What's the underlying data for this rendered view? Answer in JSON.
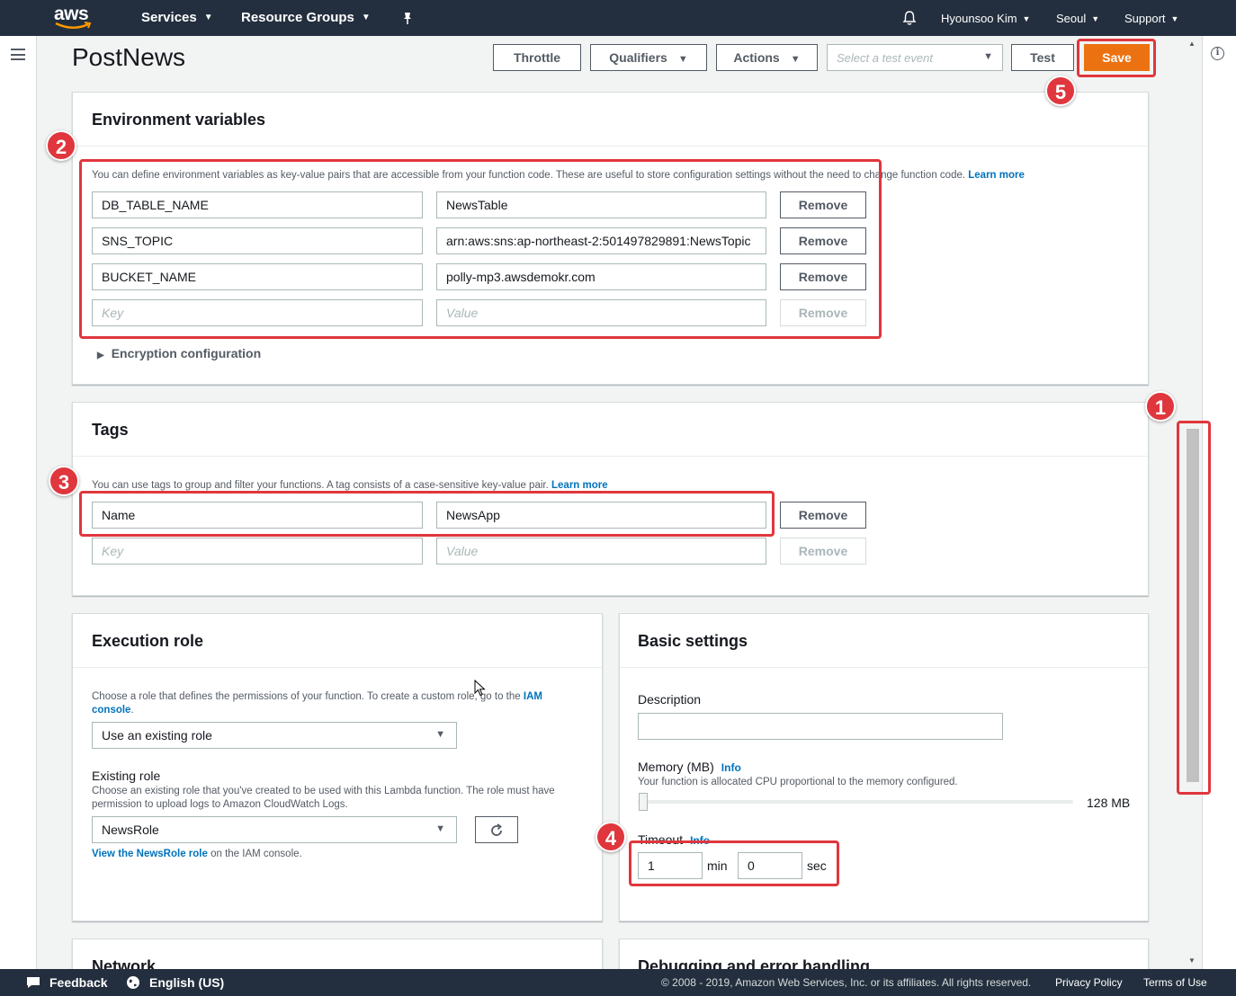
{
  "nav": {
    "logo": "aws",
    "services": "Services",
    "resource_groups": "Resource Groups",
    "pin_icon": "pin-icon",
    "bell_icon": "bell-icon",
    "user": "Hyounsoo Kim",
    "region": "Seoul",
    "support": "Support"
  },
  "header": {
    "title": "PostNews",
    "throttle": "Throttle",
    "qualifiers": "Qualifiers",
    "actions": "Actions",
    "test_event_placeholder": "Select a test event",
    "test": "Test",
    "save": "Save"
  },
  "env": {
    "title": "Environment variables",
    "help": "You can define environment variables as key-value pairs that are accessible from your function code. These are useful to store configuration settings without the need to change function code.",
    "learn_more": "Learn more",
    "rows": [
      {
        "key": "DB_TABLE_NAME",
        "value": "NewsTable",
        "remove": "Remove"
      },
      {
        "key": "SNS_TOPIC",
        "value": "arn:aws:sns:ap-northeast-2:501497829891:NewsTopic",
        "remove": "Remove"
      },
      {
        "key": "BUCKET_NAME",
        "value": "polly-mp3.awsdemokr.com",
        "remove": "Remove"
      }
    ],
    "empty_key": "Key",
    "empty_value": "Value",
    "empty_remove": "Remove",
    "encryption": "Encryption configuration"
  },
  "tags": {
    "title": "Tags",
    "help": "You can use tags to group and filter your functions. A tag consists of a case-sensitive key-value pair.",
    "learn_more": "Learn more",
    "rows": [
      {
        "key": "Name",
        "value": "NewsApp",
        "remove": "Remove"
      }
    ],
    "empty_key": "Key",
    "empty_value": "Value",
    "empty_remove": "Remove"
  },
  "exec_role": {
    "title": "Execution role",
    "help": "Choose a role that defines the permissions of your function. To create a custom role, go to the",
    "iam_link_1": "IAM",
    "iam_link_2": "console",
    "role_select": "Use an existing role",
    "existing_label": "Existing role",
    "existing_help": "Choose an existing role that you've created to be used with this Lambda function. The role must have permission to upload logs to Amazon CloudWatch Logs.",
    "existing_value": "NewsRole",
    "view_link": "View the NewsRole role",
    "view_suffix": " on the IAM console."
  },
  "basic": {
    "title": "Basic settings",
    "description_label": "Description",
    "description_value": "",
    "memory_label": "Memory (MB)",
    "memory_info": "Info",
    "memory_help": "Your function is allocated CPU proportional to the memory configured.",
    "memory_value": "128 MB",
    "timeout_label": "Timeout",
    "timeout_info": "Info",
    "timeout_min": "1",
    "min_label": "min",
    "timeout_sec": "0",
    "sec_label": "sec"
  },
  "network": {
    "title": "Network"
  },
  "debugging": {
    "title": "Debugging and error handling"
  },
  "annotations": [
    "1",
    "2",
    "3",
    "4",
    "5"
  ],
  "footer": {
    "feedback": "Feedback",
    "language": "English (US)",
    "copyright": "© 2008 - 2019, Amazon Web Services, Inc. or its affiliates. All rights reserved.",
    "privacy": "Privacy Policy",
    "terms": "Terms of Use"
  },
  "colors": {
    "nav_bg": "#232f3e",
    "save_orange": "#ec7211",
    "annotation_red": "#e0363d",
    "link_blue": "#0073bb"
  }
}
